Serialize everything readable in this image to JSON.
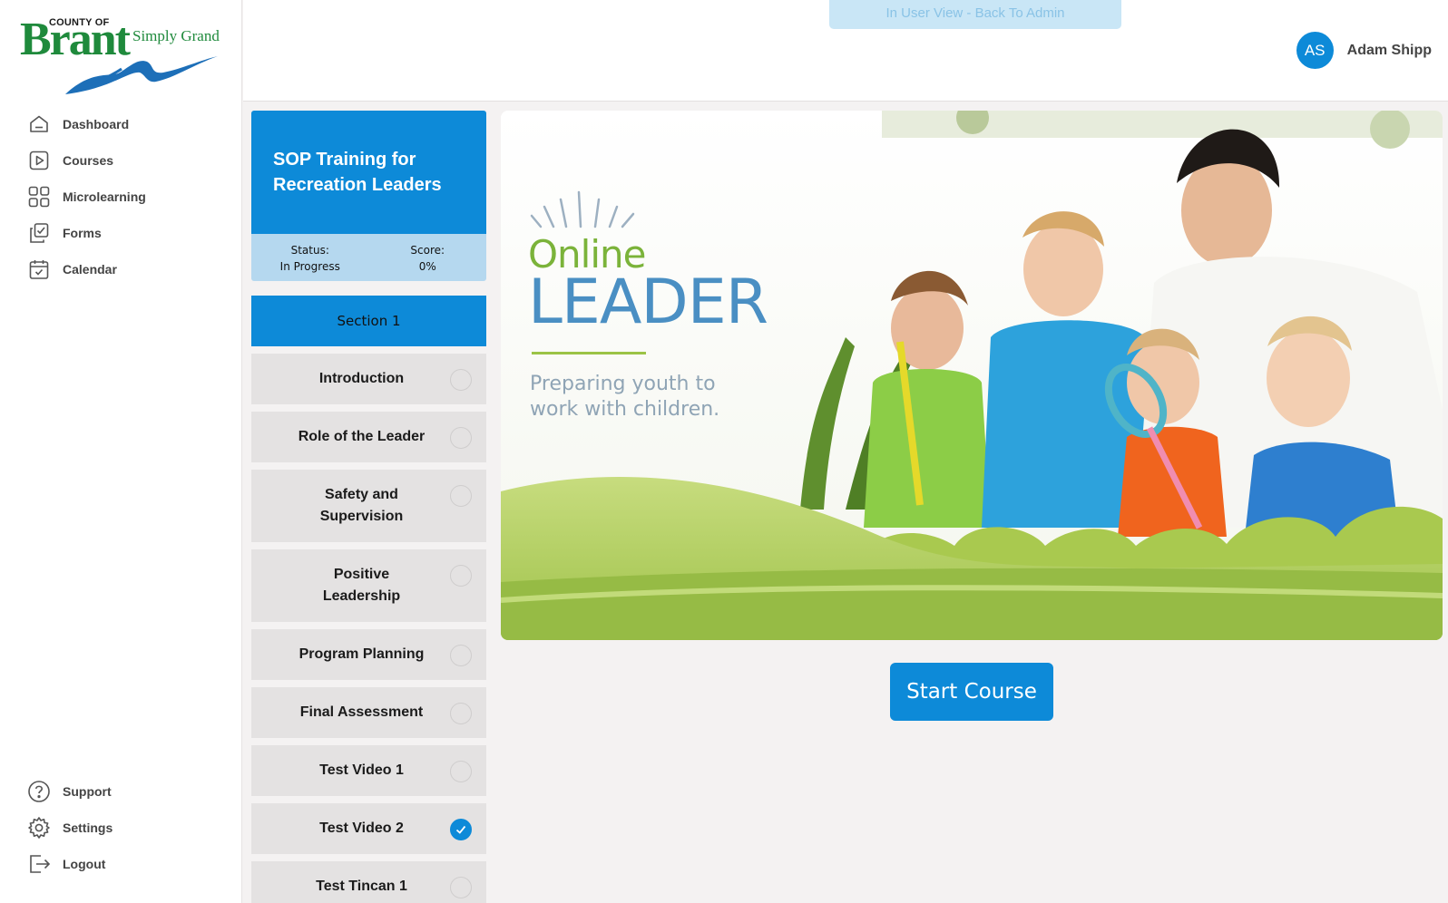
{
  "brand": {
    "county": "COUNTY OF",
    "name": "Brant",
    "tagline": "Simply Grand"
  },
  "nav": {
    "items": [
      {
        "label": "Dashboard",
        "icon": "home-icon"
      },
      {
        "label": "Courses",
        "icon": "play-icon"
      },
      {
        "label": "Microlearning",
        "icon": "grid-icon"
      },
      {
        "label": "Forms",
        "icon": "forms-icon"
      },
      {
        "label": "Calendar",
        "icon": "calendar-icon"
      }
    ],
    "bottom": [
      {
        "label": "Support",
        "icon": "help-icon"
      },
      {
        "label": "Settings",
        "icon": "gear-icon"
      },
      {
        "label": "Logout",
        "icon": "logout-icon"
      }
    ]
  },
  "topbar": {
    "admin_banner": "In User View - Back To Admin",
    "user": {
      "initials": "AS",
      "name": "Adam Shipp"
    }
  },
  "course": {
    "title": "SOP Training for Recreation Leaders",
    "status_label": "Status:",
    "status_value": "In Progress",
    "score_label": "Score:",
    "score_value": "0%",
    "section": "Section 1",
    "lessons": [
      {
        "title": "Introduction",
        "completed": false
      },
      {
        "title": "Role of the Leader",
        "completed": false
      },
      {
        "title": "Safety and Supervision",
        "completed": false
      },
      {
        "title": "Positive Leadership",
        "completed": false
      },
      {
        "title": "Program Planning",
        "completed": false
      },
      {
        "title": "Final Assessment",
        "completed": false
      },
      {
        "title": "Test Video 1",
        "completed": false
      },
      {
        "title": "Test Video 2",
        "completed": true
      },
      {
        "title": "Test Tincan 1",
        "completed": false
      }
    ]
  },
  "hero": {
    "online": "Online",
    "leader": "LEADER",
    "subtitle": "Preparing youth to work with children."
  },
  "actions": {
    "start_course": "Start Course"
  },
  "colors": {
    "primary": "#0d8ad8",
    "stats_bg": "#b5d8ef",
    "brand_green": "#1f8a3c"
  }
}
